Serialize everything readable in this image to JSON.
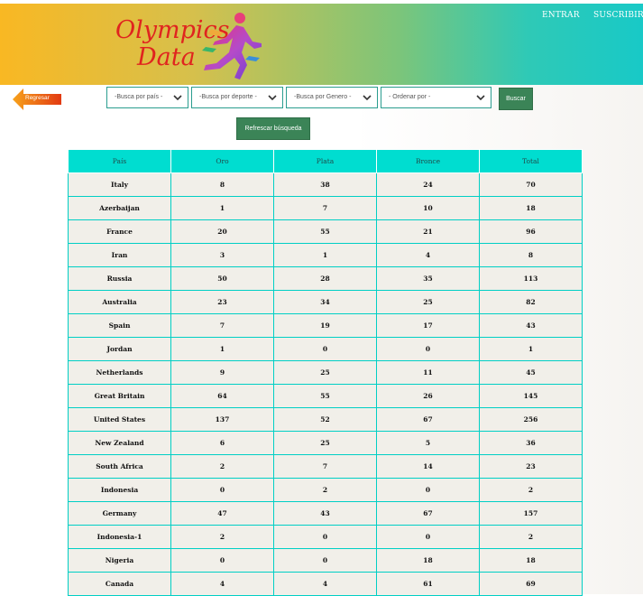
{
  "header": {
    "logo_line1": "Olympics",
    "logo_line2": "Data",
    "nav": {
      "login": "ENTRAR",
      "signup": "SUSCRIBIRSE"
    },
    "colors": {
      "gradient_start": "#f9b823",
      "gradient_end": "#18c9c7",
      "logo_text": "#e0241f"
    }
  },
  "toolbar": {
    "back_label": "Regresar",
    "filters": [
      {
        "label": "-Busca por país -"
      },
      {
        "label": "-Busca por deporte -"
      },
      {
        "label": "-Busca por Genero -"
      },
      {
        "label": "- Ordenar por -"
      }
    ],
    "search_label": "Buscar",
    "refresh_label": "Refrescar búsqueda"
  },
  "table": {
    "headers": [
      "País",
      "Oro",
      "Plata",
      "Bronce",
      "Total"
    ],
    "rows": [
      [
        "Italy",
        "8",
        "38",
        "24",
        "70"
      ],
      [
        "Azerbaijan",
        "1",
        "7",
        "10",
        "18"
      ],
      [
        "France",
        "20",
        "55",
        "21",
        "96"
      ],
      [
        "Iran",
        "3",
        "1",
        "4",
        "8"
      ],
      [
        "Russia",
        "50",
        "28",
        "35",
        "113"
      ],
      [
        "Australia",
        "23",
        "34",
        "25",
        "82"
      ],
      [
        "Spain",
        "7",
        "19",
        "17",
        "43"
      ],
      [
        "Jordan",
        "1",
        "0",
        "0",
        "1"
      ],
      [
        "Netherlands",
        "9",
        "25",
        "11",
        "45"
      ],
      [
        "Great Britain",
        "64",
        "55",
        "26",
        "145"
      ],
      [
        "United States",
        "137",
        "52",
        "67",
        "256"
      ],
      [
        "New Zealand",
        "6",
        "25",
        "5",
        "36"
      ],
      [
        "South Africa",
        "2",
        "7",
        "14",
        "23"
      ],
      [
        "Indonesia",
        "0",
        "2",
        "0",
        "2"
      ],
      [
        "Germany",
        "47",
        "43",
        "67",
        "157"
      ],
      [
        "Indonesia-1",
        "2",
        "0",
        "0",
        "2"
      ],
      [
        "Nigeria",
        "0",
        "0",
        "18",
        "18"
      ],
      [
        "Canada",
        "4",
        "4",
        "61",
        "69"
      ]
    ],
    "colors": {
      "header_bg": "#00ddd0",
      "row_bg": "#f1efe9",
      "border": "#00cfc5"
    }
  },
  "icons": {
    "back": "arrow-left-icon",
    "dropdown": "chevron-down-icon",
    "logo": "runner-icon"
  }
}
